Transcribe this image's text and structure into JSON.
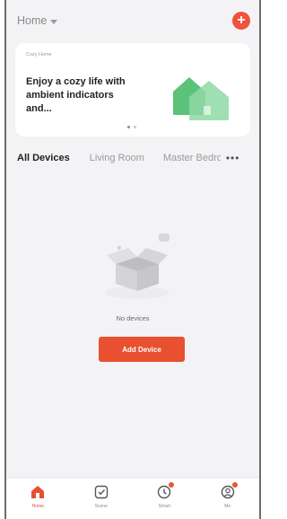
{
  "header": {
    "home_label": "Home"
  },
  "banner": {
    "brand": "Cozy Home",
    "headline": "Enjoy a cozy life with ambient indicators and...",
    "pages": 2,
    "active_page": 1
  },
  "tabs": [
    {
      "label": "All Devices",
      "active": true
    },
    {
      "label": "Living Room",
      "active": false
    },
    {
      "label": "Master Bedroom",
      "active": false
    }
  ],
  "more_glyph": "•••",
  "empty_state": {
    "message": "No devices",
    "button_label": "Add Device"
  },
  "nav": [
    {
      "label": "Home",
      "active": true
    },
    {
      "label": "Scene",
      "active": false
    },
    {
      "label": "Smart",
      "active": false,
      "badge": true
    },
    {
      "label": "Me",
      "active": false,
      "badge": true
    }
  ],
  "colors": {
    "accent": "#e8502f",
    "add_button": "#f1523a",
    "house_green": "#5cc27a"
  }
}
